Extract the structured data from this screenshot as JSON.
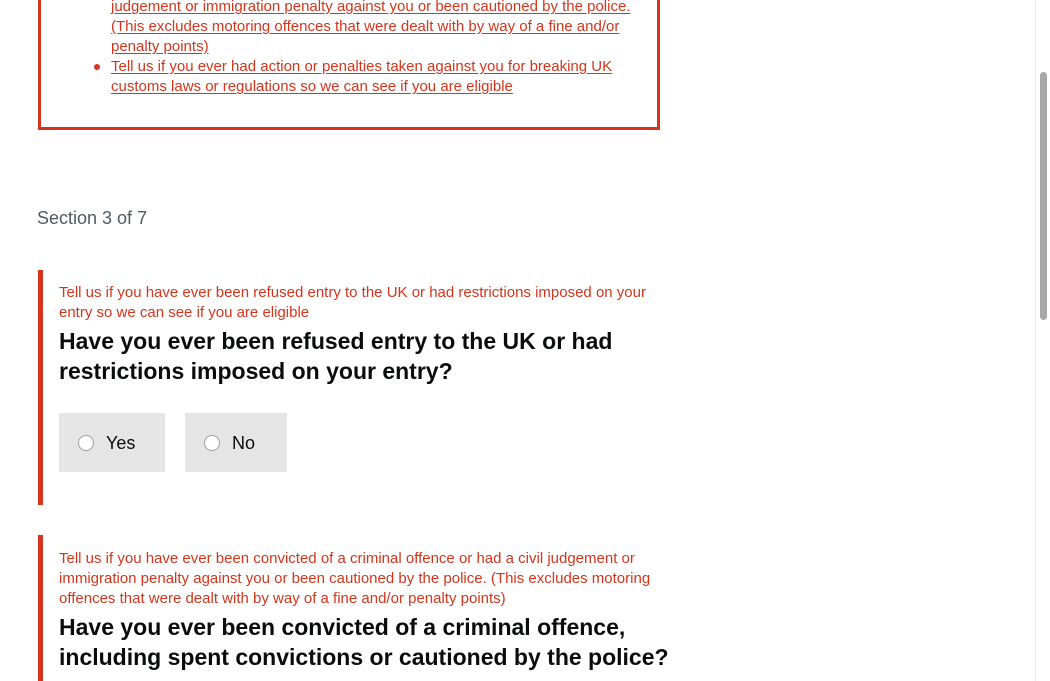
{
  "error_summary": {
    "items": [
      "Tell us if you have ever been convicted of a criminal offence or had a civil judgement or immigration penalty against you or been cautioned by the police. (This excludes motoring offences that were dealt with by way of a fine and/or penalty points)",
      "Tell us if you ever had action or penalties taken against you for breaking UK customs laws or regulations so we can see if you are eligible"
    ]
  },
  "section": {
    "caption": "Section 3 of 7"
  },
  "questions": [
    {
      "error": "Tell us if you have ever been refused entry to the UK or had restrictions imposed on your entry so we can see if you are eligible",
      "text": "Have you ever been refused entry to the UK or had restrictions imposed on your entry?",
      "options": [
        "Yes",
        "No"
      ]
    },
    {
      "error": "Tell us if you have ever been convicted of a criminal offence or had a civil judgement or immigration penalty against you or been cautioned by the police. (This excludes motoring offences that were dealt with by way of a fine and/or penalty points)",
      "text": "Have you ever been convicted of a criminal offence, including spent convictions or cautioned by the police?"
    }
  ],
  "colors": {
    "error": "#d4351c",
    "text": "#0b0c0c",
    "caption": "#505a5f",
    "radio_tile": "#e5e5e5"
  }
}
